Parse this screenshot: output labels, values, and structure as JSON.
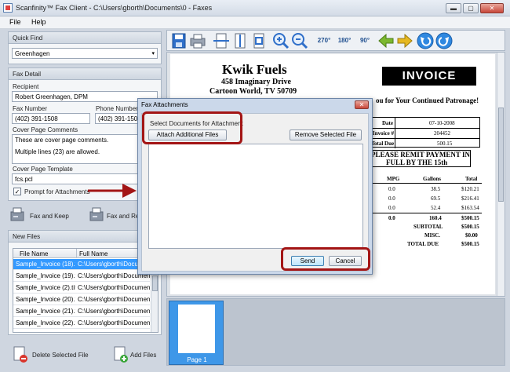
{
  "window": {
    "title": "Scanfinity™ Fax Client - C:\\Users\\gborth\\Documents\\0 - Faxes",
    "minimize": "▬",
    "maximize": "▢",
    "close": "✕"
  },
  "menu": {
    "file": "File",
    "help": "Help"
  },
  "quick_find": {
    "header": "Quick Find",
    "value": "Greenhagen"
  },
  "fax_detail": {
    "header": "Fax Detail",
    "recipient_label": "Recipient",
    "recipient_value": "Robert Greenhagen, DPM",
    "fax_number_label": "Fax Number",
    "fax_number_value": "(402) 391-1508",
    "phone_number_label": "Phone Number",
    "phone_number_value": "(402) 391-1508",
    "cover_comments_label": "Cover Page Comments",
    "cover_comments_line1": "These are cover page comments.",
    "cover_comments_line2": "Multiple lines (23) are allowed.",
    "cover_template_label": "Cover Page Template",
    "cover_template_value": "fcs.pcl",
    "prompt_attachments_label": "Prompt for Attachments",
    "prompt_attachments_checked": "✓"
  },
  "actions": {
    "fax_and_keep": "Fax and Keep",
    "fax_and_remove": "Fax and Ren"
  },
  "new_files": {
    "header": "New Files",
    "col_file_name": "File Name",
    "col_full_name": "Full Name",
    "rows": [
      {
        "file": "Sample_Invoice (18).tif",
        "full": "C:\\Users\\gborth\\Documents"
      },
      {
        "file": "Sample_Invoice (19).tif",
        "full": "C:\\Users\\gborth\\Documents"
      },
      {
        "file": "Sample_Invoice (2).tif",
        "full": "C:\\Users\\gborth\\Documents"
      },
      {
        "file": "Sample_Invoice (20).tif",
        "full": "C:\\Users\\gborth\\Documents"
      },
      {
        "file": "Sample_Invoice (21).tif",
        "full": "C:\\Users\\gborth\\Documents"
      },
      {
        "file": "Sample_Invoice (22).tif",
        "full": "C:\\Users\\gborth\\Documents"
      }
    ]
  },
  "bottom": {
    "delete_selected": "Delete Selected File",
    "add_files": "Add Files"
  },
  "toolbar": {
    "rotate270": "270°",
    "rotate180": "180°",
    "rotate90": "90°"
  },
  "invoice": {
    "company": "Kwik Fuels",
    "address1": "458 Imaginary Drive",
    "address2": "Cartoon World, TV 50709",
    "title": "INVOICE",
    "thanks": "ou for Your Continued Patronage!",
    "date_label": "Date",
    "date_value": "07-10-2008",
    "invoice_no_label": "Invoice #",
    "invoice_no_value": "204452",
    "total_due_label": "Total Due",
    "total_due_value": "500.15",
    "remit_line1": "PLEASE REMIT PAYMENT IN",
    "remit_line2": "FULL BY THE 15th",
    "col_mpg": "MPG",
    "col_gallons": "Gallons",
    "col_total": "Total",
    "rows": [
      {
        "mpg": "0.0",
        "gallons": "38.5",
        "total": "$120.21"
      },
      {
        "mpg": "0.0",
        "gallons": "69.5",
        "total": "$216.41"
      },
      {
        "mpg": "0.0",
        "gallons": "52.4",
        "total": "$163.54"
      },
      {
        "mpg": "0.0",
        "gallons": "160.4",
        "total": "$500.15"
      }
    ],
    "subtotal_label": "SUBTOTAL",
    "subtotal_value": "$500.15",
    "misc_label": "MISC.",
    "misc_value": "$0.00",
    "totaldue_label": "TOTAL DUE",
    "totaldue_value": "$500.15"
  },
  "thumbnail": {
    "label": "Page 1"
  },
  "dialog": {
    "title": "Fax Attachments",
    "close": "✕",
    "select_label": "Select Documents for Attachment",
    "attach_button": "Attach Additional Files",
    "remove_button": "Remove Selected File",
    "send_button": "Send",
    "cancel_button": "Cancel"
  }
}
